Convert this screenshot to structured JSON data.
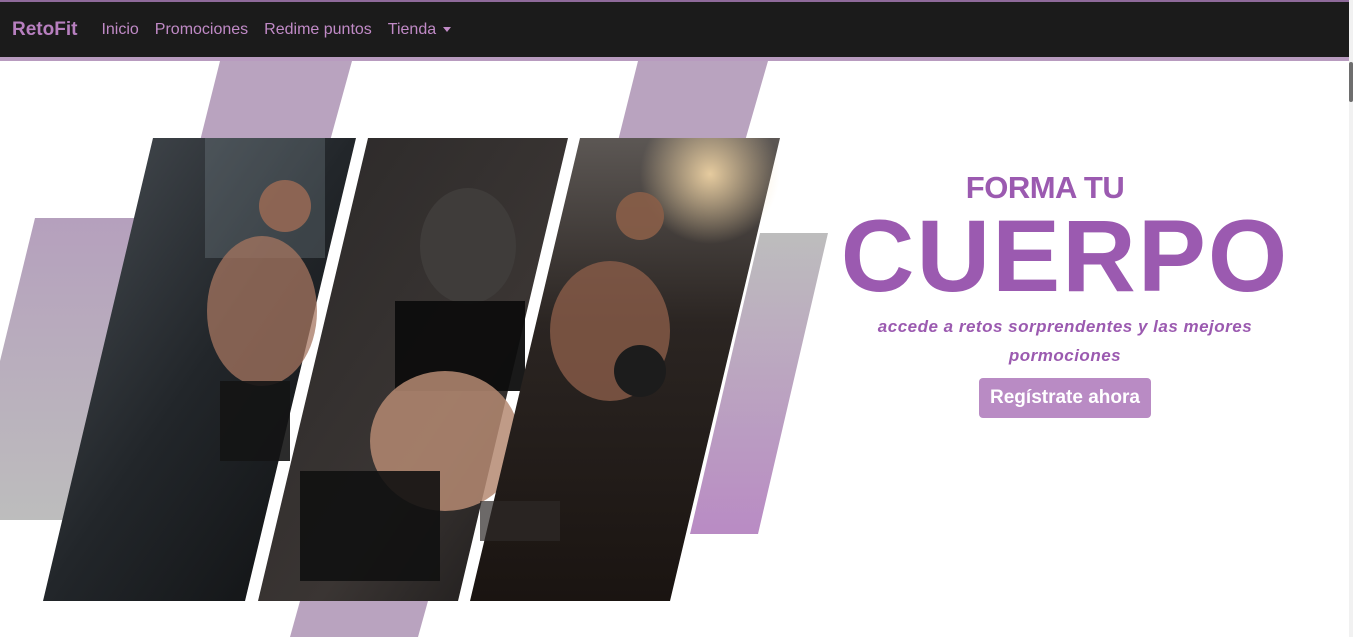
{
  "navbar": {
    "brand": "RetoFit",
    "links": [
      {
        "label": "Inicio"
      },
      {
        "label": "Promociones"
      },
      {
        "label": "Redime puntos"
      },
      {
        "label": "Tienda"
      }
    ]
  },
  "hero": {
    "kicker": "FORMA TU",
    "title": "CUERPO",
    "subtitle": "accede a retos sorprendentes y las mejores pormociones",
    "cta": "Regístrate ahora"
  },
  "colors": {
    "accent": "#9b5ab0",
    "nav_bg": "#1b1b1b",
    "nav_link": "#c08ac6",
    "button_bg": "#b98bc4",
    "stripe_purple": "#b9a3bf"
  },
  "icons": {
    "dropdown": "caret-down-icon"
  }
}
